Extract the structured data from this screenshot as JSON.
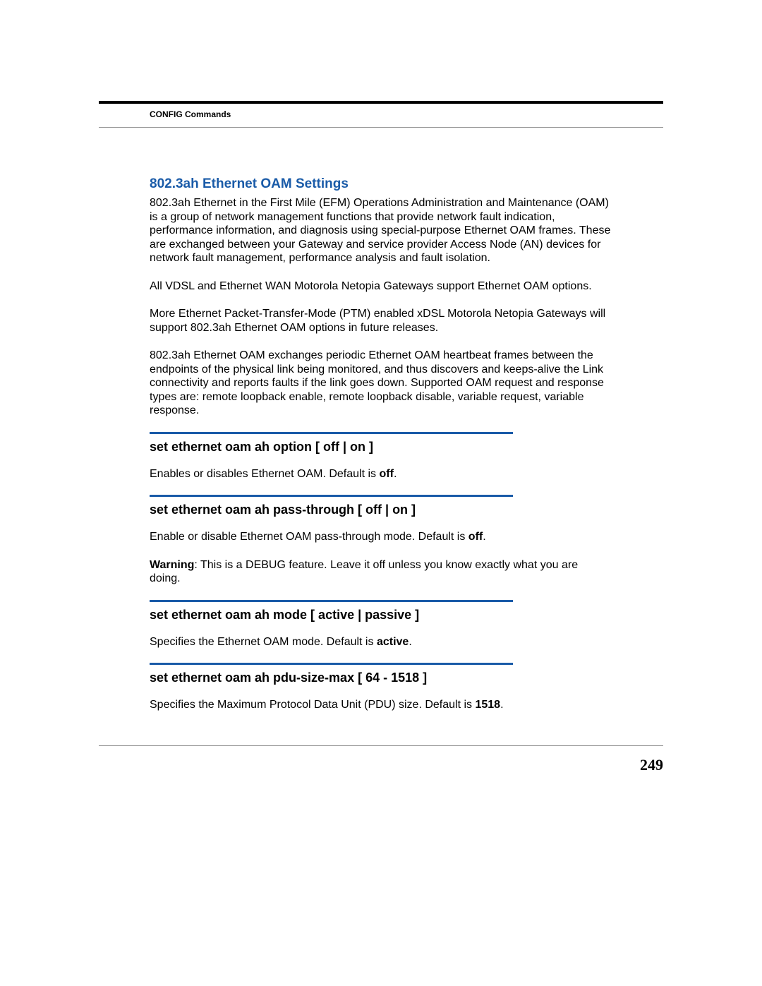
{
  "header": {
    "section": "CONFIG Commands"
  },
  "page_number": "249",
  "title": "802.3ah Ethernet OAM Settings",
  "paras": {
    "intro": "802.3ah Ethernet in the First Mile (EFM) Operations Administration and Maintenance (OAM) is a group of network management functions that provide network fault indication, performance information, and diagnosis using special-purpose Ethernet OAM frames. These are exchanged between your Gateway and service provider Access Node (AN) devices for network fault management, performance analysis and fault isolation.",
    "support": "All VDSL and Ethernet WAN Motorola Netopia Gateways support Ethernet OAM options.",
    "future": "More Ethernet Packet-Transfer-Mode (PTM) enabled xDSL Motorola Netopia Gateways will support 802.3ah Ethernet OAM options in future releases.",
    "exchange": "802.3ah Ethernet OAM exchanges periodic Ethernet OAM heartbeat frames between the endpoints of the physical link being monitored, and thus discovers and keeps-alive the Link connectivity and reports faults if the link goes down. Supported OAM request and response types are: remote loopback enable, remote loopback disable, variable request, variable response."
  },
  "commands": {
    "option": {
      "heading": "set ethernet oam ah option [ off | on ]",
      "desc_prefix": "Enables or disables Ethernet OAM. Default is ",
      "default": "off",
      "desc_suffix": "."
    },
    "passthrough": {
      "heading": "set ethernet oam ah pass-through [ off | on ]",
      "desc_prefix": "Enable or disable Ethernet OAM pass-through mode. Default is ",
      "default": "off",
      "desc_suffix": ".",
      "warning_label": "Warning",
      "warning_text": ": This is a DEBUG feature. Leave it off unless you know exactly what you are doing."
    },
    "mode": {
      "heading": "set ethernet oam ah mode [ active | passive ]",
      "desc_prefix": "Specifies the Ethernet OAM mode. Default is ",
      "default": "active",
      "desc_suffix": "."
    },
    "pdu": {
      "heading": "set ethernet oam ah pdu-size-max [ 64 - 1518 ]",
      "desc_prefix": "Specifies the Maximum Protocol Data Unit (PDU) size. Default is ",
      "default": "1518",
      "desc_suffix": "."
    }
  }
}
